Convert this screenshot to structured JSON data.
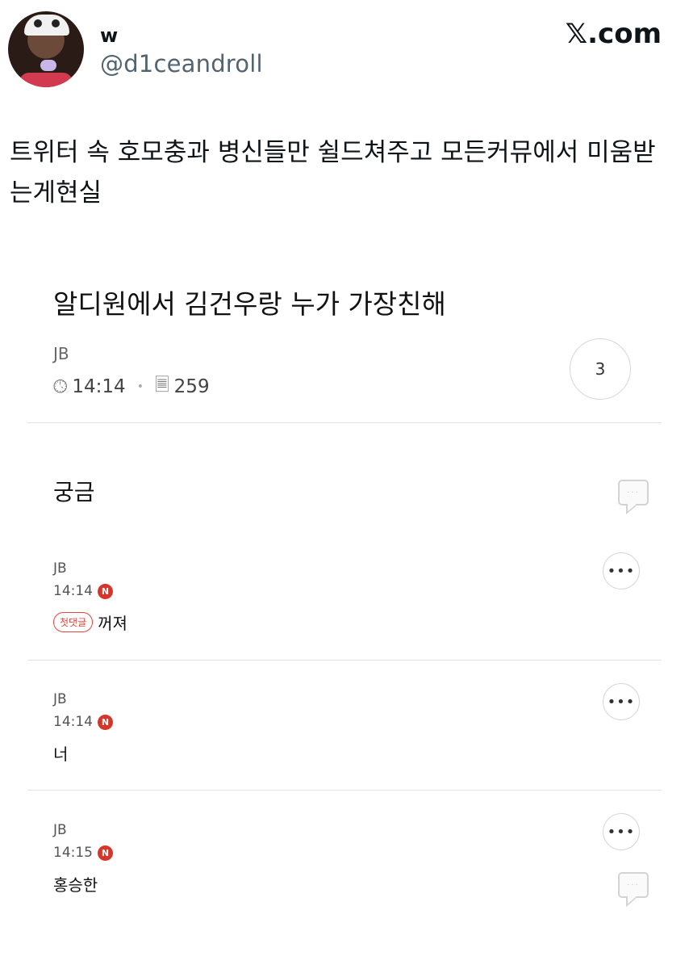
{
  "tweet": {
    "user_name": "w",
    "handle": "@d1ceandroll",
    "site_label": "𝕏.com",
    "text": "트위터 속 호모충과 병신들만 쉴드쳐주고 모든커뮤에서 미움받는게현실"
  },
  "post": {
    "title": "알디원에서 김건우랑 누가 가장친해",
    "author": "JB",
    "time": "14:14",
    "views": "259",
    "comment_count": "3",
    "section_title": "궁금"
  },
  "comments": [
    {
      "author": "JB",
      "time": "14:14",
      "badge": "N",
      "tag": "첫댓글",
      "text": "꺼져"
    },
    {
      "author": "JB",
      "time": "14:14",
      "badge": "N",
      "text": "너"
    },
    {
      "author": "JB",
      "time": "14:15",
      "badge": "N",
      "text": "홍승한"
    }
  ],
  "icons": {
    "clock": "clock-icon",
    "views": "document-icon",
    "more": "more-icon",
    "reply": "speech-bubble-icon",
    "new_badge_color": "#d6362a",
    "first_tag_color": "#e0473d"
  }
}
